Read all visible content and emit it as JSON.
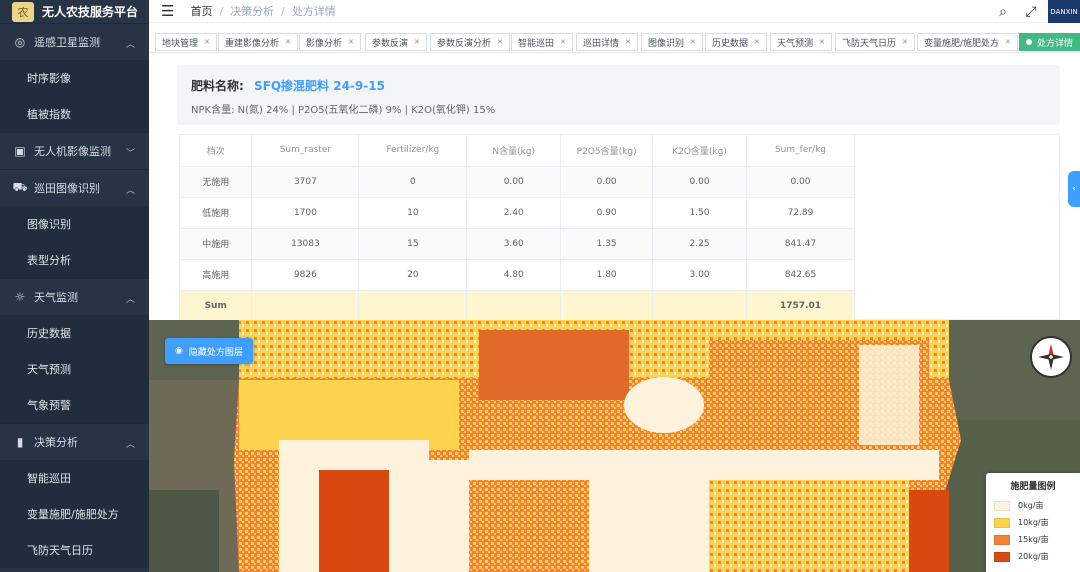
{
  "brand": {
    "title": "无人农技服务平台",
    "logo": "农"
  },
  "sidebar": {
    "groups": [
      {
        "label": "遥感卫星监测",
        "icon": "eye-icon",
        "glyph": "◎",
        "items": [
          "时序影像",
          "植被指数"
        ]
      },
      {
        "label": "无人机影像监测",
        "icon": "camera-icon",
        "glyph": "▣",
        "items": []
      },
      {
        "label": "巡田图像识别",
        "icon": "tractor-icon",
        "glyph": "⛟",
        "items": [
          "图像识别",
          "表型分析"
        ]
      },
      {
        "label": "天气监测",
        "icon": "sun-icon",
        "glyph": "☼",
        "items": [
          "历史数据",
          "天气预测",
          "气象预警"
        ]
      },
      {
        "label": "决策分析",
        "icon": "chart-bars-icon",
        "glyph": "▮",
        "items": [
          "智能巡田",
          "变量施肥/施肥处方",
          "飞防天气日历"
        ]
      }
    ]
  },
  "navbar": {
    "breadcrumb": [
      "首页",
      "决策分析",
      "处方详情"
    ],
    "avatar_text": "DANXIN"
  },
  "tags": [
    {
      "label": "地块管理",
      "active": false
    },
    {
      "label": "重建影像分析",
      "active": false
    },
    {
      "label": "影像分析",
      "active": false
    },
    {
      "label": "参数反演",
      "active": false
    },
    {
      "label": "参数反演分析",
      "active": false
    },
    {
      "label": "智能巡田",
      "active": false
    },
    {
      "label": "巡田详情",
      "active": false
    },
    {
      "label": "图像识别",
      "active": false
    },
    {
      "label": "历史数据",
      "active": false
    },
    {
      "label": "天气预测",
      "active": false
    },
    {
      "label": "飞防天气日历",
      "active": false
    },
    {
      "label": "变量施肥/施肥处方",
      "active": false
    },
    {
      "label": "处方详情",
      "active": true
    }
  ],
  "fertilizer": {
    "label": "肥料名称:",
    "name": "SFQ掺混肥料 24-9-15",
    "npk": "NPK含量: N(氮) 24% | P2O5(五氧化二磷) 9% | K2O(氧化钾) 15%"
  },
  "table": {
    "headers": [
      "档次",
      "Sum_raster",
      "Fertilizer/kg",
      "N含量(kg)",
      "P2O5含量(kg)",
      "K2O含量(kg)",
      "Sum_fer/kg"
    ],
    "rows": [
      [
        "无施用",
        "3707",
        "0",
        "0.00",
        "0.00",
        "0.00",
        "0.00"
      ],
      [
        "低施用",
        "1700",
        "10",
        "2.40",
        "0.90",
        "1.50",
        "72.89"
      ],
      [
        "中施用",
        "13083",
        "15",
        "3.60",
        "1.35",
        "2.25",
        "841.47"
      ],
      [
        "高施用",
        "9826",
        "20",
        "4.80",
        "1.80",
        "3.00",
        "842.65"
      ]
    ],
    "sum_row": [
      "Sum",
      "",
      "",
      "",
      "",
      "",
      "1757.01"
    ]
  },
  "map": {
    "toggle_button": "隐藏处方图层",
    "legend_title": "施肥量图例",
    "legend": [
      {
        "label": "0kg/亩",
        "color": "#fdf3dc"
      },
      {
        "label": "10kg/亩",
        "color": "#fcd34d"
      },
      {
        "label": "15kg/亩",
        "color": "#f4813a"
      },
      {
        "label": "20kg/亩",
        "color": "#d9480f"
      }
    ]
  },
  "colors": {
    "sidebar_bg": "#263445",
    "accent_blue": "#409eff",
    "active_tag": "#42b983"
  }
}
